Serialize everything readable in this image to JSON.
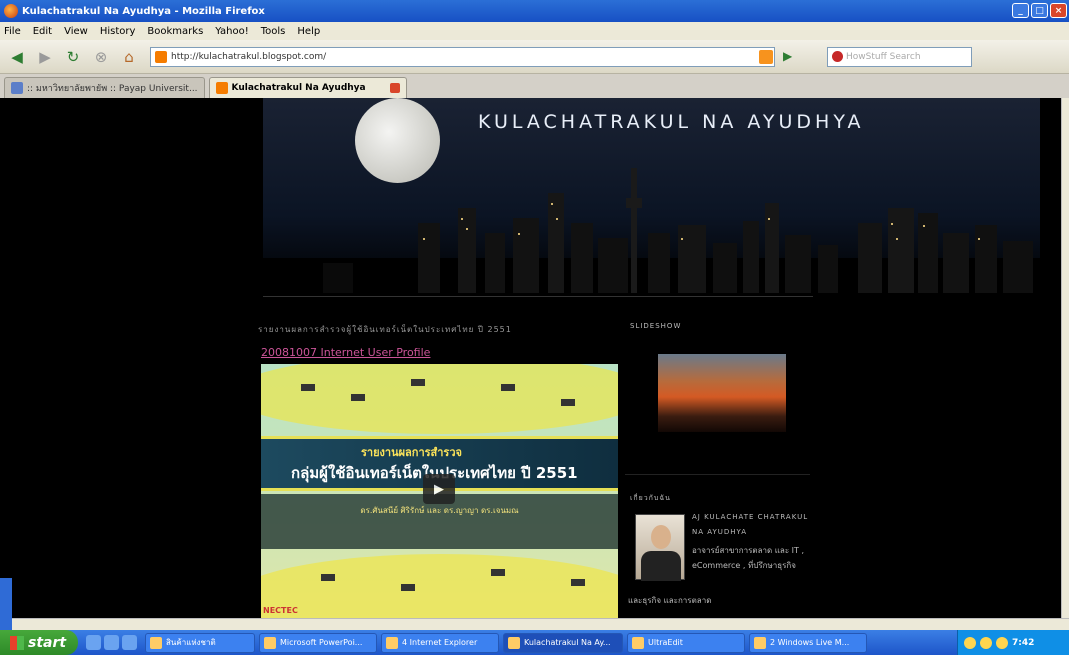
{
  "window": {
    "title": "Kulachatrakul Na Ayudhya - Mozilla Firefox"
  },
  "menu": {
    "items": [
      "File",
      "Edit",
      "View",
      "History",
      "Bookmarks",
      "Yahoo!",
      "Tools",
      "Help"
    ]
  },
  "nav": {
    "url": "http://kulachatrakul.blogspot.com/",
    "search_placeholder": "HowStuff Search"
  },
  "tabs": [
    {
      "label": ":: มหาวิทยาลัยพายัพ :: Payap Universit..."
    },
    {
      "label": "Kulachatrakul Na Ayudhya"
    }
  ],
  "blog": {
    "title": "KULACHATRAKUL NA AYUDHYA",
    "post_heading": "รายงานผลการสำรวจผู้ใช้อินเทอร์เน็ตในประเทศไทย ปี 2551",
    "post_link": "20081007 Internet User Profile",
    "slide_line1": "รายงานผลการสำรวจ",
    "slide_line2": "กลุ่มผู้ใช้อินเทอร์เน็ตในประเทศไทย ปี 2551",
    "slide_sub": "ดร.ศันสนีย์ ศิริรักษ์ และ ดร.ญาญา ดร.เจนมณ",
    "nectec": "NECTEC"
  },
  "sidebar": {
    "slideshow_title": "SLIDESHOW",
    "about_title": "เกี่ยวกับฉัน",
    "about_name": "AJ KULACHATE CHATRAKUL NA AYUDHYA",
    "about_text": "อาจารย์สาขาการตลาด และ IT , eCommerce , ที่ปรึกษาธุรกิจ",
    "about_tail": "และธุรกิจ และการตลาด"
  },
  "taskbar": {
    "start": "start",
    "items": [
      "สินค้าแห่งชาติ",
      "Microsoft PowerPoi...",
      "4 Internet Explorer",
      "Kulachatrakul Na Ay...",
      "UltraEdit",
      "2 Windows Live M..."
    ],
    "time": "7:42"
  }
}
